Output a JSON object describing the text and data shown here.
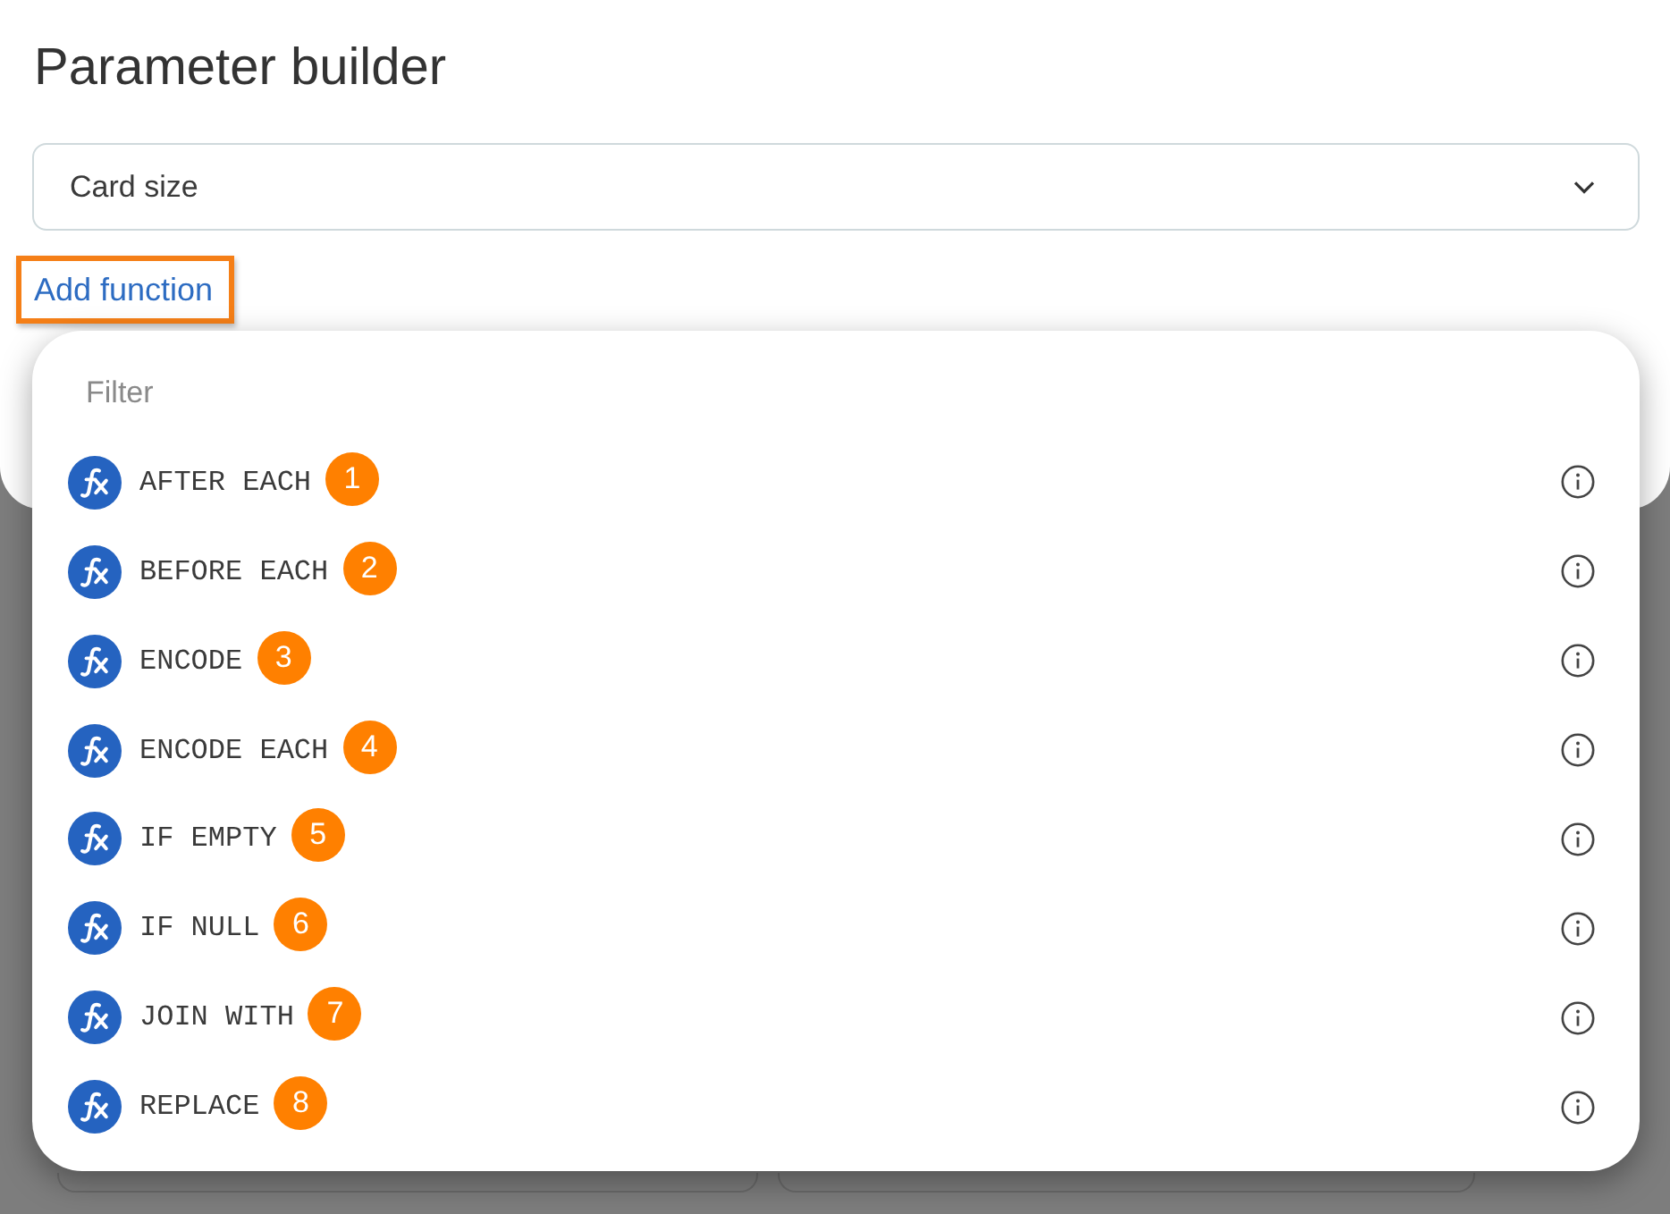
{
  "title": "Parameter builder",
  "parameter_select": {
    "value": "Card size"
  },
  "add_function_link": {
    "label": "Add function",
    "highlighted": true
  },
  "function_menu": {
    "filter": {
      "placeholder": "Filter"
    },
    "items": [
      {
        "name": "AFTER EACH",
        "badge": "1"
      },
      {
        "name": "BEFORE EACH",
        "badge": "2"
      },
      {
        "name": "ENCODE",
        "badge": "3"
      },
      {
        "name": "ENCODE EACH",
        "badge": "4"
      },
      {
        "name": "IF EMPTY",
        "badge": "5"
      },
      {
        "name": "IF NULL",
        "badge": "6"
      },
      {
        "name": "JOIN WITH",
        "badge": "7"
      },
      {
        "name": "REPLACE",
        "badge": "8"
      }
    ]
  }
}
